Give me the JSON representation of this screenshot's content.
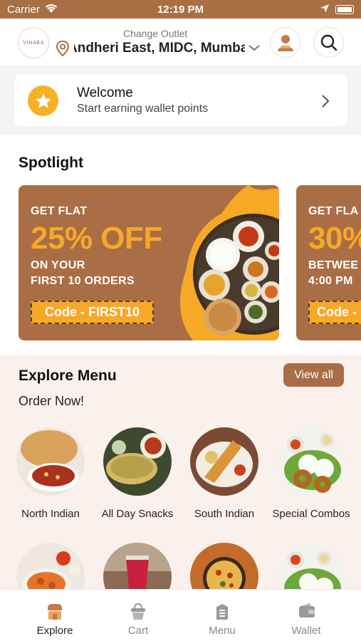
{
  "status_bar": {
    "carrier": "Carrier",
    "time": "12:19 PM"
  },
  "header": {
    "logo_text": "VIHARA",
    "outlet_caption": "Change Outlet",
    "outlet_name": "Andheri East, MIDC, Mumbai"
  },
  "welcome": {
    "title": "Welcome",
    "subtitle": "Start earning wallet points"
  },
  "spotlight": {
    "title": "Spotlight",
    "banners": [
      {
        "line1": "GET FLAT",
        "discount": "25% OFF",
        "line3": "ON YOUR",
        "line4": "FIRST 10 ORDERS",
        "code": "Code - FIRST10"
      },
      {
        "line1": "GET FLA",
        "discount": "30%",
        "line3": "BETWEE",
        "line4": "4:00 PM",
        "code": "Code - S"
      }
    ]
  },
  "explore_menu": {
    "title": "Explore Menu",
    "view_all": "View all",
    "subtitle": "Order Now!",
    "categories": [
      {
        "label": "North Indian"
      },
      {
        "label": "All Day Snacks"
      },
      {
        "label": "South Indian"
      },
      {
        "label": "Special Combos"
      },
      {
        "label": ""
      },
      {
        "label": ""
      },
      {
        "label": ""
      },
      {
        "label": ""
      }
    ]
  },
  "tabbar": {
    "tabs": [
      {
        "label": "Explore",
        "active": true
      },
      {
        "label": "Cart"
      },
      {
        "label": "Menu"
      },
      {
        "label": "Wallet"
      }
    ]
  },
  "colors": {
    "brand": "#a96e46",
    "accent": "#f6a827",
    "star": "#f4b224"
  }
}
